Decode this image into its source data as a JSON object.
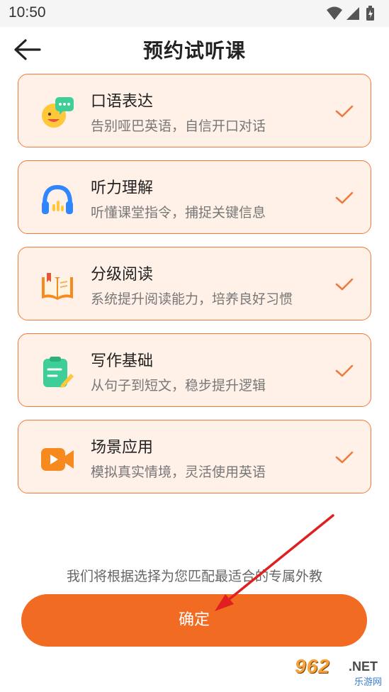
{
  "status_bar": {
    "time": "10:50"
  },
  "header": {
    "title": "预约试听课"
  },
  "courses": [
    {
      "title": "口语表达",
      "subtitle": "告别哑巴英语，自信开口对话",
      "icon": "speech-face-icon",
      "checked": true
    },
    {
      "title": "听力理解",
      "subtitle": "听懂课堂指令，捕捉关键信息",
      "icon": "headphones-icon",
      "checked": true
    },
    {
      "title": "分级阅读",
      "subtitle": "系统提升阅读能力，培养良好习惯",
      "icon": "open-book-icon",
      "checked": true
    },
    {
      "title": "写作基础",
      "subtitle": "从句子到短文，稳步提升逻辑",
      "icon": "clipboard-pen-icon",
      "checked": true
    },
    {
      "title": "场景应用",
      "subtitle": "模拟真实情境，灵活使用英语",
      "icon": "video-camera-icon",
      "checked": true
    }
  ],
  "hint": "我们将根据选择为您匹配最适合的专属外教",
  "confirm_label": "确定",
  "watermark": {
    "main": "962",
    "net": ".NET",
    "sub": "乐游网"
  },
  "colors": {
    "accent": "#f26b22",
    "card_bg": "#fff1e8",
    "card_border": "#f07a3e",
    "check": "#f07a3e"
  }
}
